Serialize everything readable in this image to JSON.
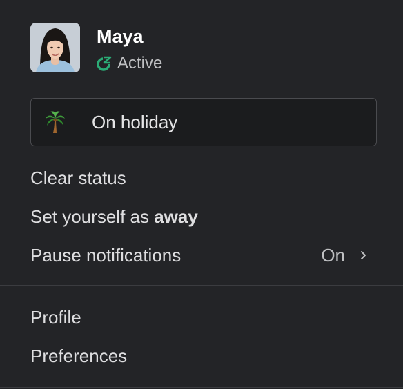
{
  "user": {
    "name": "Maya",
    "presence": "Active",
    "presence_color": "#2bac76",
    "avatar_icon": "user-portrait-avatar"
  },
  "status": {
    "emoji_icon": "palm-tree-icon",
    "text": "On holiday"
  },
  "menu_group_1": {
    "clear_status": "Clear status",
    "set_away_prefix": "Set yourself as",
    "set_away_bold": "away",
    "pause_notifications": "Pause notifications",
    "pause_notifications_value": "On",
    "pause_notifications_icon": "chevron-right-icon"
  },
  "menu_group_2": {
    "profile": "Profile",
    "preferences": "Preferences"
  },
  "colors": {
    "background": "#232427",
    "status_box_border": "#4a4b4f",
    "divider": "#3b3c40",
    "text_primary": "#dedee0",
    "text_secondary": "#bfc0c2"
  }
}
